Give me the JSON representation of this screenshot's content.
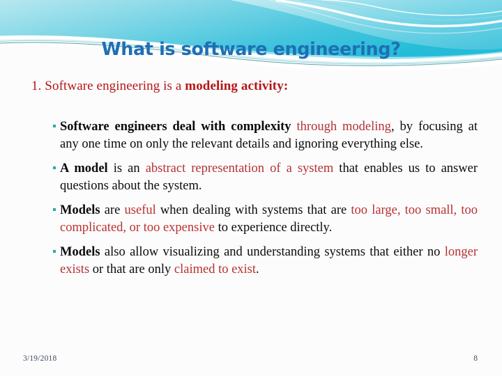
{
  "slide": {
    "title": "What is software engineering?",
    "subheading": {
      "prefix": "1. Software engineering is a ",
      "bold": "modeling activity:"
    },
    "bullets": [
      {
        "marker": "square-bullet-icon",
        "segments": [
          {
            "text": "Software engineers deal with complexity ",
            "style": "bold"
          },
          {
            "text": "through modeling",
            "style": "red"
          },
          {
            "text": ", by  focusing   at any one time on only the relevant details and ignoring everything else.",
            "style": "normal"
          }
        ]
      },
      {
        "marker": "square-bullet-icon",
        "segments": [
          {
            "text": "A model",
            "style": "bold"
          },
          {
            "text": " is an ",
            "style": "normal"
          },
          {
            "text": "abstract representation of a system",
            "style": "red"
          },
          {
            "text": " that enables us to answer questions about the system.",
            "style": "normal"
          }
        ]
      },
      {
        "marker": "square-bullet-icon",
        "segments": [
          {
            "text": "Models",
            "style": "bold"
          },
          {
            "text": " are ",
            "style": "normal"
          },
          {
            "text": "useful",
            "style": "red"
          },
          {
            "text": " when dealing with systems that are ",
            "style": "normal"
          },
          {
            "text": "too large, too small, too complicated, or too expensive",
            "style": "red"
          },
          {
            "text": " to experience directly.",
            "style": "normal"
          }
        ]
      },
      {
        "marker": "square-bullet-icon",
        "segments": [
          {
            "text": "Models",
            "style": "bold"
          },
          {
            "text": " also allow visualizing and understanding systems that either no ",
            "style": "normal"
          },
          {
            "text": "longer exists",
            "style": "red"
          },
          {
            "text": " or that are only ",
            "style": "normal"
          },
          {
            "text": "claimed to exist",
            "style": "red"
          },
          {
            "text": ".",
            "style": "normal"
          }
        ]
      }
    ],
    "footer": {
      "date": "3/19/2018",
      "page_number": "8"
    }
  },
  "theme": {
    "title_color": "#1f6fb4",
    "subheading_color": "#b51616",
    "accent_red": "#b53232",
    "bullet_color": "#2aa8a8",
    "band_cyan_light": "#a8e4ef",
    "band_cyan": "#5ec8df",
    "band_cyan_deep": "#2cbbd8",
    "band_teal_line": "#3f8f95",
    "background": "#fcfcfd",
    "footer_color": "#3d4a5c"
  }
}
